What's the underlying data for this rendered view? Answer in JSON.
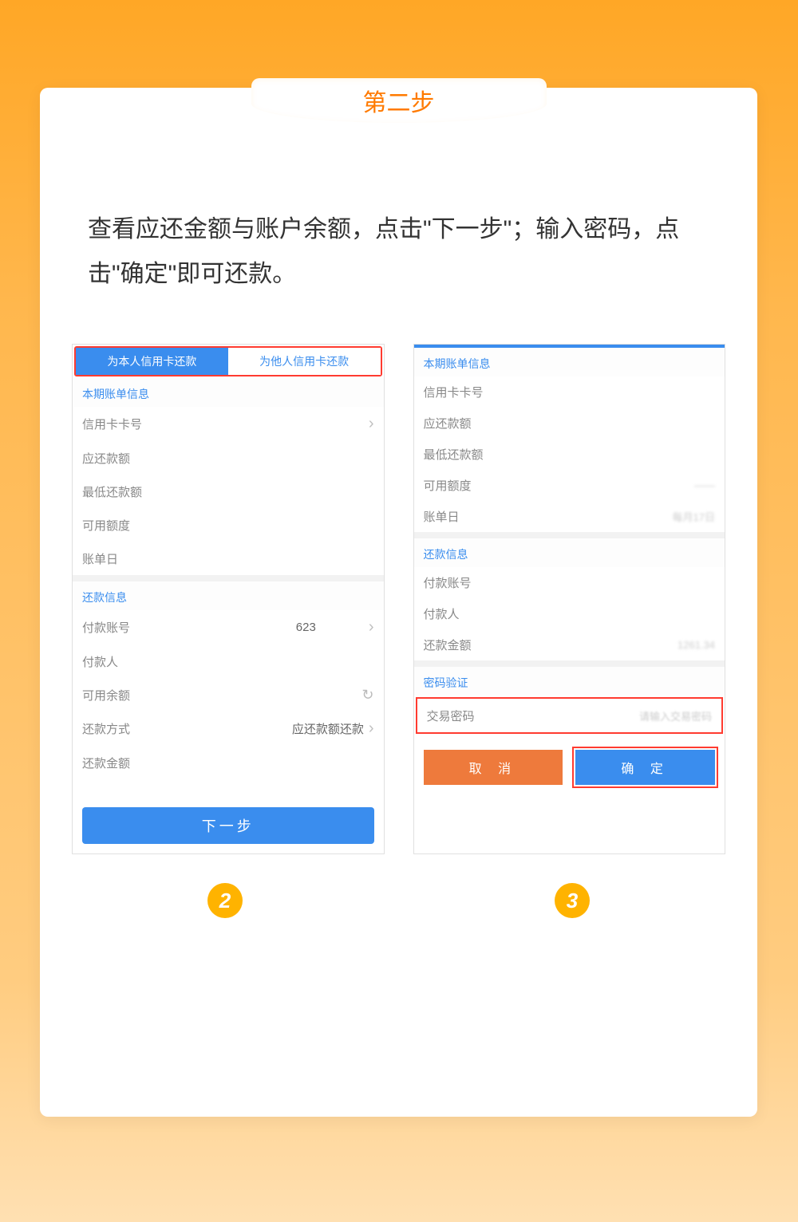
{
  "step_title": "第二步",
  "instruction": "查看应还金额与账户余额，点击\"下一步\"；输入密码，点击\"确定\"即可还款。",
  "phone1": {
    "tab_self": "为本人信用卡还款",
    "tab_other": "为他人信用卡还款",
    "section_bill": "本期账单信息",
    "card_no_label": "信用卡卡号",
    "due_label": "应还款额",
    "min_due_label": "最低还款额",
    "credit_label": "可用额度",
    "bill_date_label": "账单日",
    "section_repay": "还款信息",
    "pay_acct_label": "付款账号",
    "pay_acct_value": "623",
    "payer_label": "付款人",
    "avail_label": "可用余额",
    "method_label": "还款方式",
    "method_value": "应还款额还款",
    "amount_label": "还款金额",
    "next_btn": "下一步"
  },
  "phone2": {
    "section_bill": "本期账单信息",
    "card_no_label": "信用卡卡号",
    "due_label": "应还款额",
    "min_due_label": "最低还款额",
    "credit_label": "可用额度",
    "bill_date_label": "账单日",
    "bill_date_value": "每月17日",
    "section_repay": "还款信息",
    "pay_acct_label": "付款账号",
    "payer_label": "付款人",
    "amount_label": "还款金额",
    "amount_value": "1261.34",
    "section_pwd": "密码验证",
    "pwd_label": "交易密码",
    "pwd_placeholder": "请输入交易密码",
    "cancel_btn": "取 消",
    "confirm_btn": "确 定"
  },
  "badges": {
    "left": "2",
    "right": "3"
  }
}
